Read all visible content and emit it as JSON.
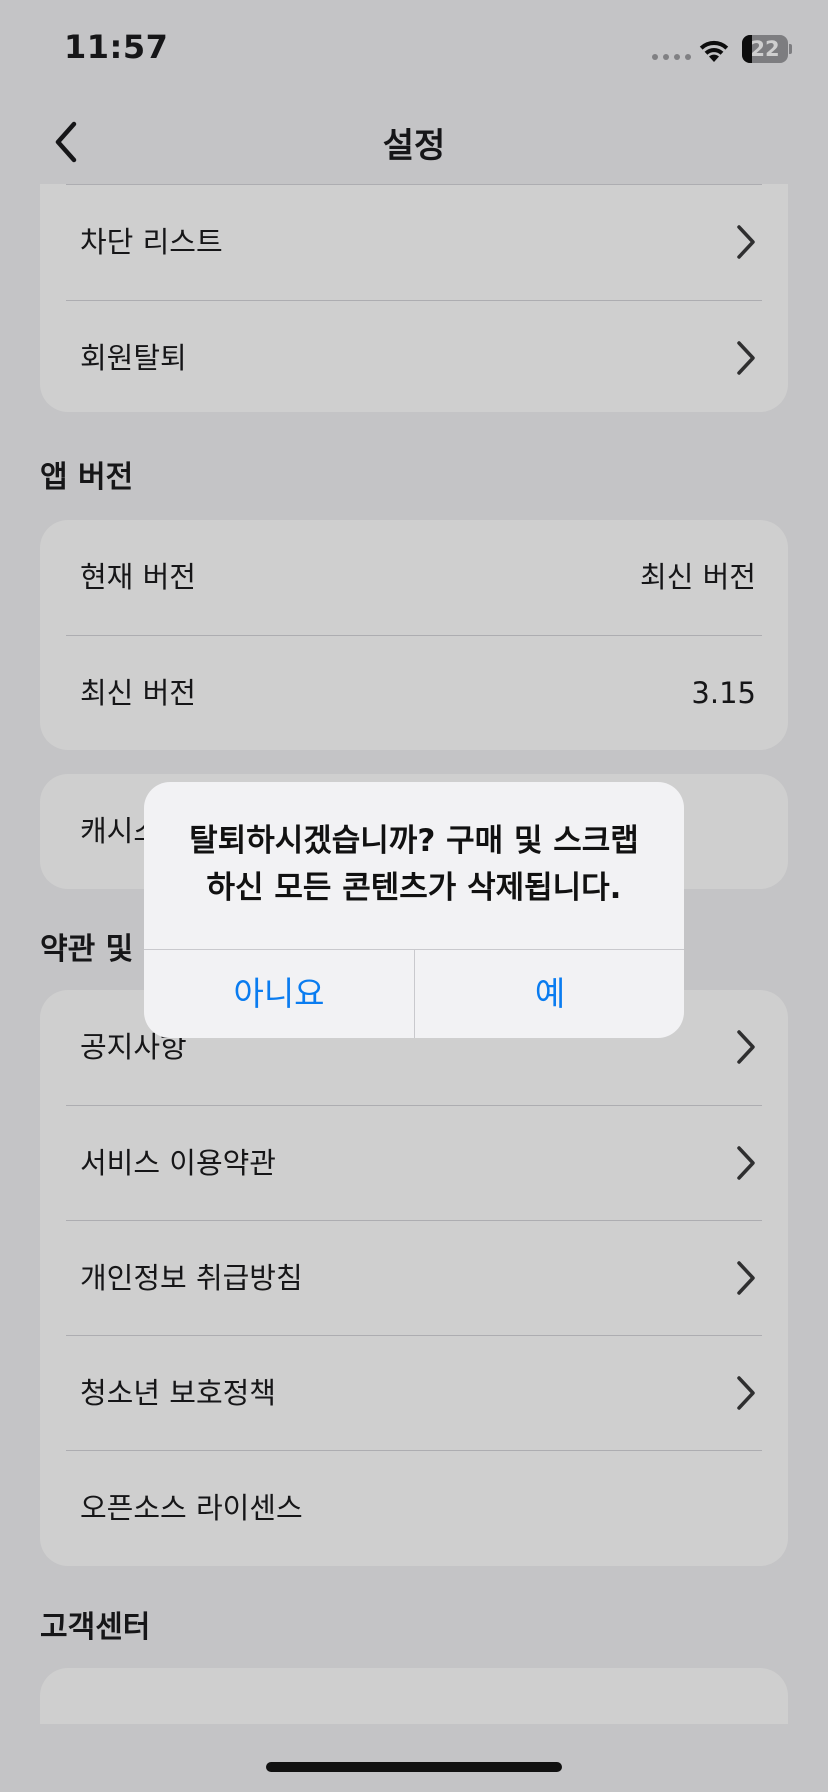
{
  "status_bar": {
    "time": "11:57",
    "battery_level": "22",
    "battery_fraction": 0.22
  },
  "nav": {
    "title": "설정",
    "back_icon": "chevron-left-icon"
  },
  "account_group": {
    "items": [
      {
        "label": "차단 리스트",
        "icon": "chevron-right-icon"
      },
      {
        "label": "회원탈퇴",
        "icon": "chevron-right-icon"
      }
    ]
  },
  "app_version": {
    "header": "앱 버전",
    "items": [
      {
        "label": "현재 버전",
        "value": "최신 버전"
      },
      {
        "label": "최신 버전",
        "value": "3.15"
      }
    ]
  },
  "cache_group": {
    "label_partial": "캐시스"
  },
  "terms": {
    "header_partial": "약관 및",
    "items": [
      {
        "label": "공지사항",
        "icon": "chevron-right-icon"
      },
      {
        "label": "서비스 이용약관",
        "icon": "chevron-right-icon"
      },
      {
        "label": "개인정보 취급방침",
        "icon": "chevron-right-icon"
      },
      {
        "label": "청소년 보호정책",
        "icon": "chevron-right-icon"
      },
      {
        "label": "오픈소스 라이센스"
      }
    ]
  },
  "support": {
    "header": "고객센터"
  },
  "alert": {
    "message_line1": "탈퇴하시겠습니까? 구매 및 스크랩",
    "message_line2": "하신 모든 콘텐츠가 삭제됩니다.",
    "no_label": "아니요",
    "yes_label": "예",
    "accent_color": "#0a7cf0"
  }
}
